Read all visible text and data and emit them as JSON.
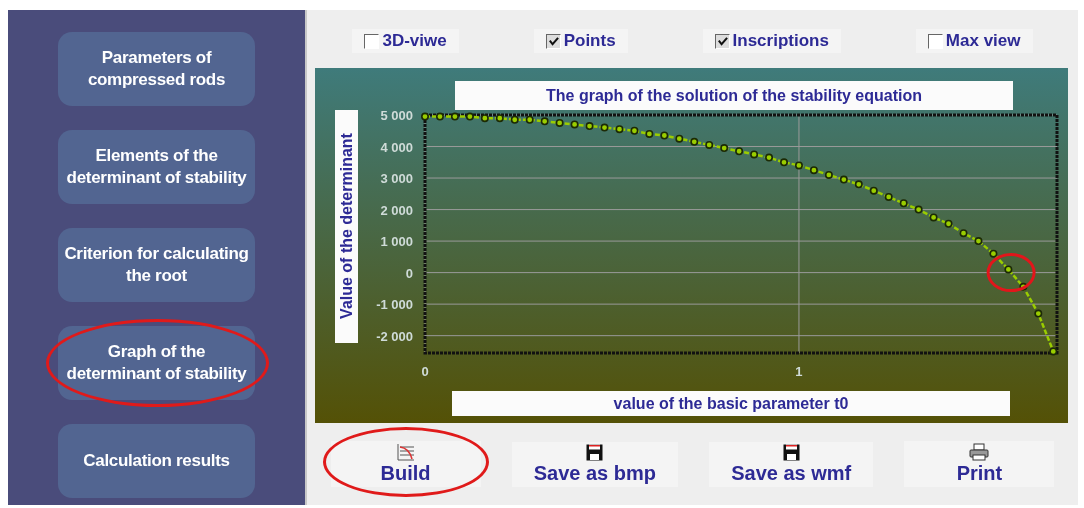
{
  "nav": [
    {
      "label": "Parameters of compressed rods",
      "circled": false
    },
    {
      "label": "Elements of the determinant of stability",
      "circled": false
    },
    {
      "label": "Criterion for calculating the root",
      "circled": false
    },
    {
      "label": "Graph of the determinant of stability",
      "circled": true
    },
    {
      "label": "Calculation results",
      "circled": false
    }
  ],
  "options": [
    {
      "label": "3D-viwe",
      "checked": false
    },
    {
      "label": "Points",
      "checked": true
    },
    {
      "label": "Inscriptions",
      "checked": true
    },
    {
      "label": "Max view",
      "checked": false
    }
  ],
  "chart": {
    "chart_data": {
      "type": "line",
      "title": "The graph of the solution of the stability equation",
      "xlabel": "value of the basic parameter t0",
      "ylabel": "Value of the determinant",
      "x": [
        0,
        0.04,
        0.08,
        0.12,
        0.16,
        0.2,
        0.24,
        0.28,
        0.32,
        0.36,
        0.4,
        0.44,
        0.48,
        0.52,
        0.56,
        0.6,
        0.64,
        0.68,
        0.72,
        0.76,
        0.8,
        0.84,
        0.88,
        0.92,
        0.96,
        1.0,
        1.04,
        1.08,
        1.12,
        1.16,
        1.2,
        1.24,
        1.28,
        1.32,
        1.36,
        1.4,
        1.44,
        1.48,
        1.52,
        1.56,
        1.6,
        1.64,
        1.68
      ],
      "series": [
        {
          "color": "#9acd00",
          "line_style": "dashed",
          "marker": "circle",
          "values": [
            4950,
            4950,
            4950,
            4950,
            4900,
            4900,
            4850,
            4850,
            4800,
            4750,
            4700,
            4650,
            4600,
            4550,
            4500,
            4400,
            4350,
            4250,
            4150,
            4050,
            3950,
            3850,
            3750,
            3650,
            3500,
            3400,
            3250,
            3100,
            2950,
            2800,
            2600,
            2400,
            2200,
            2000,
            1750,
            1550,
            1250,
            1000,
            600,
            100,
            -450,
            -1300,
            -2500
          ]
        }
      ],
      "grid": true,
      "xlim": [
        0,
        1.69
      ],
      "ylim": [
        -2550,
        5000
      ],
      "xticks": [
        0,
        1
      ],
      "yticks": [
        {
          "value": 5000,
          "label": "5 000"
        },
        {
          "value": 4000,
          "label": "4 000"
        },
        {
          "value": 3000,
          "label": "3 000"
        },
        {
          "value": 2000,
          "label": "2 000"
        },
        {
          "value": 1000,
          "label": "1 000"
        },
        {
          "value": 0,
          "label": "0"
        },
        {
          "value": -1000,
          "label": "-1 000"
        },
        {
          "value": -2000,
          "label": "-2 000"
        }
      ]
    },
    "root_circled": true
  },
  "actions": [
    {
      "label": "Build",
      "kind": "build",
      "circled": true
    },
    {
      "label": "Save as bmp",
      "kind": "save",
      "circled": false
    },
    {
      "label": "Save as wmf",
      "kind": "save",
      "circled": false
    },
    {
      "label": "Print",
      "kind": "print",
      "circled": false
    }
  ]
}
